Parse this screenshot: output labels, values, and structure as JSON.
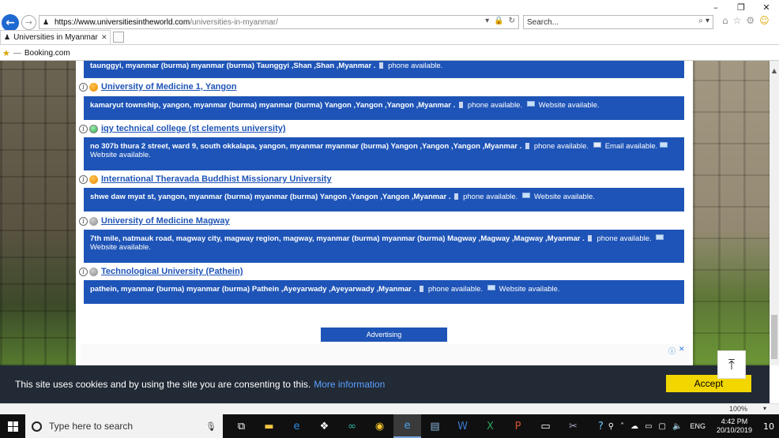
{
  "browser": {
    "url_host": "https://www.universitiesintheworld.com",
    "url_path": "/universities-in-myanmar/",
    "search_placeholder": "Search...",
    "tab_title": "Universities in Myanmar - D...",
    "favorites": [
      {
        "label": "Booking.com"
      }
    ]
  },
  "top_entry": {
    "address": "taunggyi, myanmar (burma) myanmar (burma) Taunggyi ,Shan ,Shan ,Myanmar .",
    "phone": "phone available."
  },
  "universities": [
    {
      "name": "University of Medicine 1, Yangon",
      "status": "orange",
      "address": "kamaryut township, yangon, myanmar (burma) myanmar (burma) Yangon ,Yangon ,Yangon ,Myanmar .",
      "phone": "phone available.",
      "website": "Website available."
    },
    {
      "name": "iqy technical college (st clements university)",
      "status": "green",
      "address": "no 307b thura 2 street, ward 9, south okkalapa, yangon, myanmar myanmar (burma) Yangon ,Yangon ,Yangon ,Myanmar .",
      "phone": "phone available.",
      "email": "Email available.",
      "website": "Website available."
    },
    {
      "name": "International Theravada Buddhist Missionary University",
      "status": "orange",
      "address": "shwe daw myat st, yangon, myanmar (burma) myanmar (burma) Yangon ,Yangon ,Yangon ,Myanmar .",
      "phone": "phone available.",
      "website": "Website available."
    },
    {
      "name": "University of Medicine Magway",
      "status": "gray",
      "address": "7th mile, natmauk road, magway city, magway region, magway, myanmar (burma) myanmar (burma) Magway ,Magway ,Magway ,Myanmar .",
      "phone": "phone available.",
      "website": "Website available."
    },
    {
      "name": "Technological University (Pathein)",
      "status": "gray",
      "address": "pathein, myanmar (burma) myanmar (burma) Pathein ,Ayeyarwady ,Ayeyarwady ,Myanmar .",
      "phone": "phone available.",
      "website": "Website available."
    }
  ],
  "advertising_label": "Advertising",
  "cookie": {
    "message": "This site uses cookies and by using the site you are consenting to this.",
    "link": "More information",
    "accept": "Accept"
  },
  "status_bar": {
    "zoom": "100%"
  },
  "taskbar": {
    "search_placeholder": "Type here to search",
    "language": "ENG",
    "time": "4:42 PM",
    "date": "20/10/2019",
    "notification_count": "10"
  },
  "colors": {
    "accent": "#1e54b7",
    "cookie_bg": "#222a36",
    "accept_btn": "#f1d600",
    "link": "#5aa0ff"
  }
}
